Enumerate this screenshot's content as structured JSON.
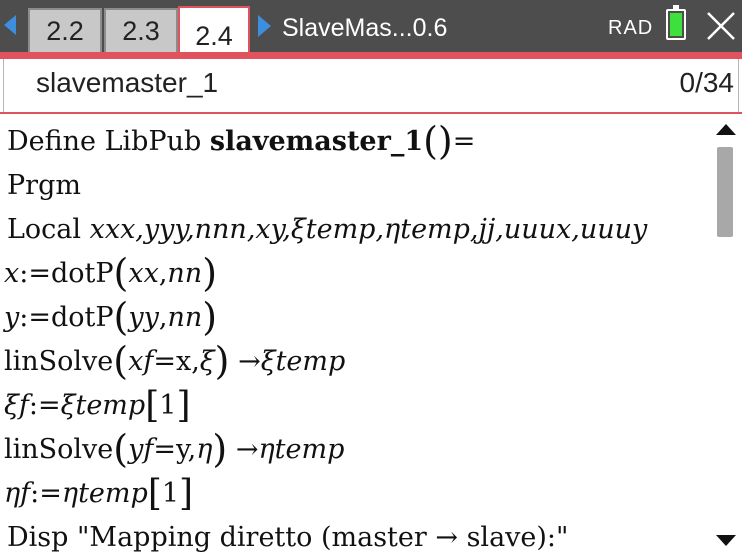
{
  "tabs": [
    {
      "label": "2.2",
      "active": false
    },
    {
      "label": "2.3",
      "active": false
    },
    {
      "label": "2.4",
      "active": true
    }
  ],
  "document_title": "SlaveMas...0.6",
  "angle_mode": "RAD",
  "program": {
    "name": "slavemaster_1",
    "position": "0/34"
  },
  "code": {
    "l1": {
      "pre": "Define LibPub ",
      "name": "slavemaster_1",
      "post": "="
    },
    "l2": "Prgm",
    "l3": {
      "pre": "Local ",
      "vars": "xxx,yyy,nnn,xy,ξtemp,ηtemp,jj,uuux,uuuy"
    },
    "l4": {
      "var": "x",
      "assign": ":=dotP",
      "arg1": "xx",
      "sep": ",",
      "arg2": "nn"
    },
    "l5": {
      "var": "y",
      "assign": ":=dotP",
      "arg1": "yy",
      "sep": ",",
      "arg2": "nn"
    },
    "l6": {
      "fn": "linSolve",
      "eq_lhs": "xf",
      "eq_rhs": "=x,",
      "sym": "ξ",
      "arrow": "→",
      "target": "ξtemp"
    },
    "l7": {
      "var": "ξf",
      "assign": ":=",
      "src": "ξtemp",
      "idx": "1"
    },
    "l8": {
      "fn": "linSolve",
      "eq_lhs": "yf",
      "eq_rhs": "=y,",
      "sym": "η",
      "arrow": "→",
      "target": "ηtemp"
    },
    "l9": {
      "var": "ηf",
      "assign": ":=",
      "src": "ηtemp",
      "idx": "1"
    },
    "l10": "Disp \"Mapping diretto (master → slave):\""
  },
  "colors": {
    "header_bg": "#4d4d4d",
    "accent": "#e0525d",
    "nav_arrow": "#3c8fde",
    "battery": "#3ee03b"
  },
  "icons": {
    "nav_left": "chevron-left-icon",
    "nav_right": "chevron-right-icon",
    "battery": "battery-icon",
    "close": "close-icon",
    "scroll_up": "scroll-up-icon",
    "scroll_down": "scroll-down-icon"
  }
}
